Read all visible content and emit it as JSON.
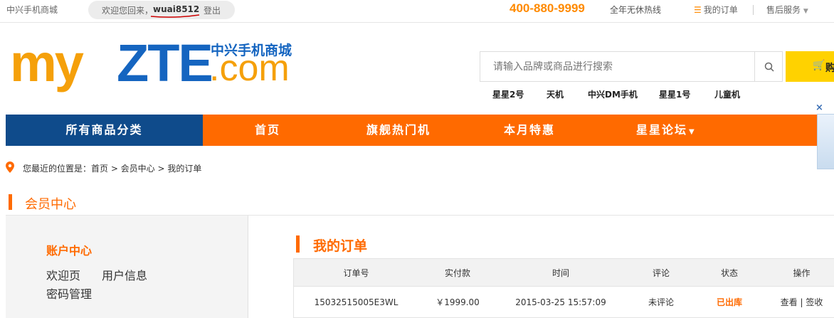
{
  "topbar": {
    "site_name": "中兴手机商城",
    "welcome": "欢迎您回来，",
    "username": "wuai8512",
    "logout": "登出",
    "hotline_number": "400-880-9999",
    "hotline_label": "全年无休热线",
    "my_orders": "我的订单",
    "after_sales": "售后服务"
  },
  "logo": {
    "my": "my",
    "zte": "ZTE",
    "cn": "中兴手机商城",
    "com": ".com"
  },
  "search": {
    "placeholder": "请输入品牌或商品进行搜索",
    "cart_label": "购"
  },
  "hot_words": [
    "星星2号",
    "天机",
    "中兴DM手机",
    "星星1号",
    "儿童机"
  ],
  "nav": {
    "all_categories": "所有商品分类",
    "items": [
      "首页",
      "旗舰热门机",
      "本月特惠",
      "星星论坛"
    ]
  },
  "breadcrumb": "您最近的位置是：首页 > 会员中心 > 我的订单",
  "member_center": {
    "title": "会员中心",
    "account_title": "账户中心",
    "links": [
      "欢迎页",
      "用户信息",
      "密码管理"
    ]
  },
  "orders": {
    "title": "我的订单",
    "columns": [
      "订单号",
      "实付款",
      "时间",
      "评论",
      "状态",
      "操作"
    ],
    "rows": [
      {
        "order_no": "15032515005E3WL",
        "paid": "￥1999.00",
        "time": "2015-03-25 15:57:09",
        "review": "未评论",
        "status": "已出库",
        "actions": "查看 | 签收"
      }
    ]
  },
  "colors": {
    "orange": "#ff6a00",
    "navy": "#0f4b8b",
    "yellow": "#ffd200",
    "logo_orange": "#f5a00a",
    "logo_blue": "#1565c0"
  }
}
